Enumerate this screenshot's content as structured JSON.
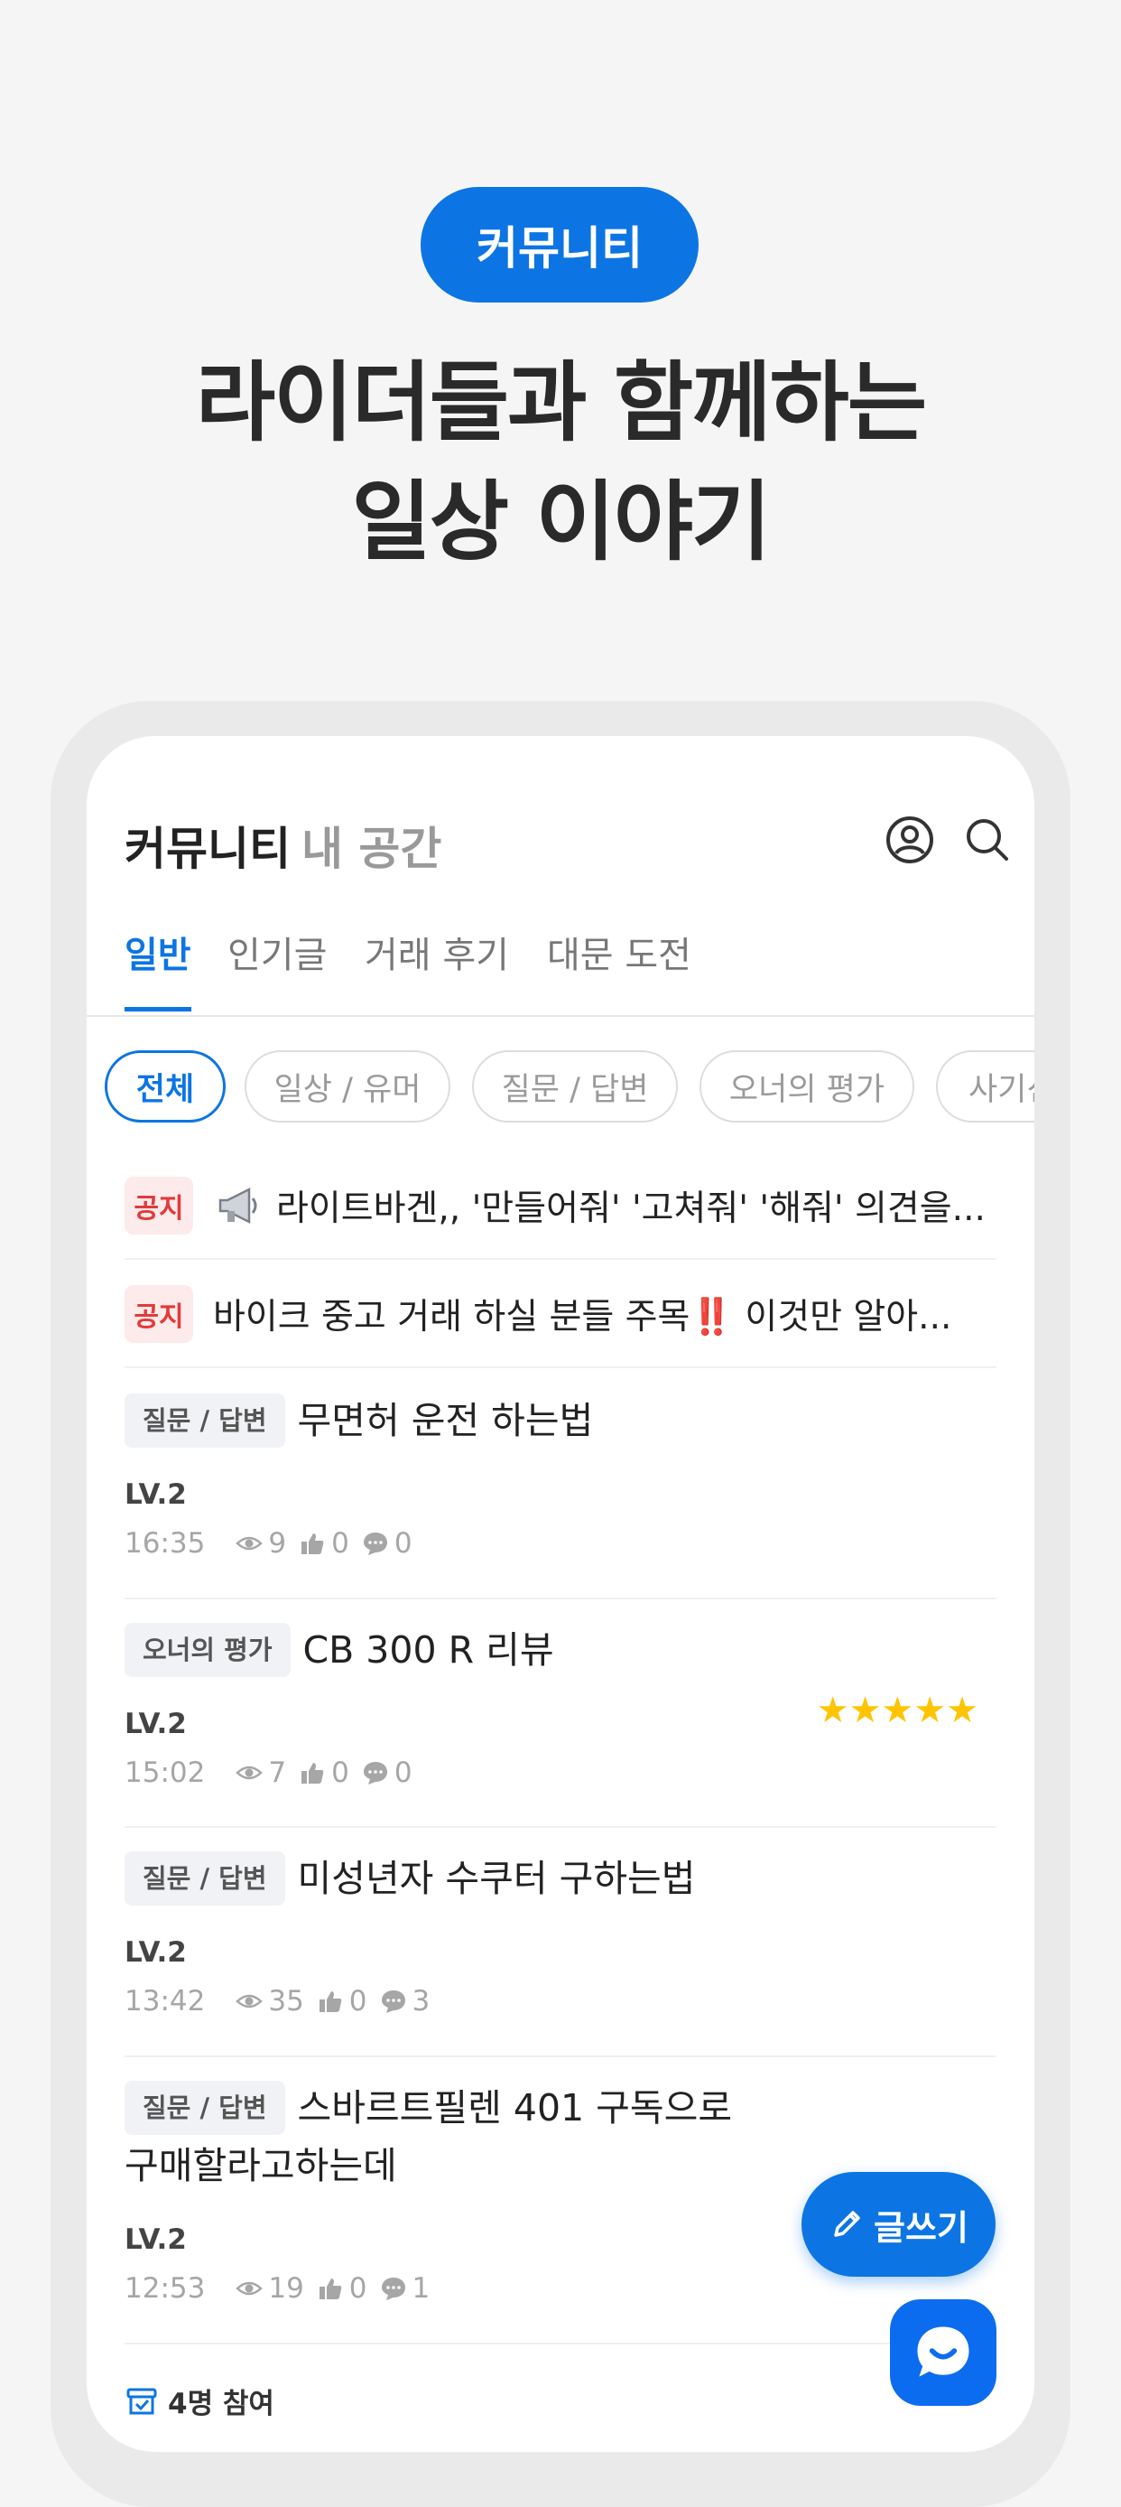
{
  "promo": {
    "pill_label": "커뮤니티",
    "headline_line1": "라이더들과 함께하는",
    "headline_line2": "일상 이야기"
  },
  "header": {
    "title": "커뮤니티",
    "subtitle": "내 공간",
    "icons": [
      "profile-icon",
      "search-icon"
    ]
  },
  "tabs": [
    {
      "label": "일반",
      "active": true
    },
    {
      "label": "인기글",
      "active": false
    },
    {
      "label": "거래 후기",
      "active": false
    },
    {
      "label": "대문 도전",
      "active": false
    }
  ],
  "chips": [
    {
      "label": "전체",
      "active": true
    },
    {
      "label": "일상 / 유머",
      "active": false
    },
    {
      "label": "질문 / 답변",
      "active": false
    },
    {
      "label": "오너의 평가",
      "active": false
    },
    {
      "label": "사기신",
      "active": false
    }
  ],
  "notices": [
    {
      "badge": "공지",
      "text": "라이트바겐,, '만들어줘' '고쳐줘' '해줘' 의견을...",
      "icon": "megaphone-icon"
    },
    {
      "badge": "공지",
      "text": "바이크 중고 거래 하실 분들 주목‼️ 이것만 알아..."
    }
  ],
  "posts": [
    {
      "category": "질문 / 답변",
      "title": "무면허 운전 하는법",
      "level": "LV.2",
      "time": "16:35",
      "views": "9",
      "likes": "0",
      "comments": "0"
    },
    {
      "category": "오너의 평가",
      "title": "CB 300 R 리뷰",
      "level": "LV.2",
      "time": "15:02",
      "views": "7",
      "likes": "0",
      "comments": "0",
      "stars": "★★★★★",
      "rating": 5
    },
    {
      "category": "질문 / 답변",
      "title": "미성년자 수쿠터 구하는법",
      "level": "LV.2",
      "time": "13:42",
      "views": "35",
      "likes": "0",
      "comments": "3"
    },
    {
      "category": "질문 / 답변",
      "title": "스바르트필렌 401 구독으로",
      "title_line2": "구매할라고하는데",
      "level": "LV.2",
      "time": "12:53",
      "views": "19",
      "likes": "0",
      "comments": "1"
    }
  ],
  "fab": {
    "write_label": "글쓰기"
  },
  "participation": {
    "text": "4명 참여"
  },
  "colors": {
    "accent": "#0c75e3",
    "notice_red": "#e23a3a",
    "star": "#ffc400"
  }
}
